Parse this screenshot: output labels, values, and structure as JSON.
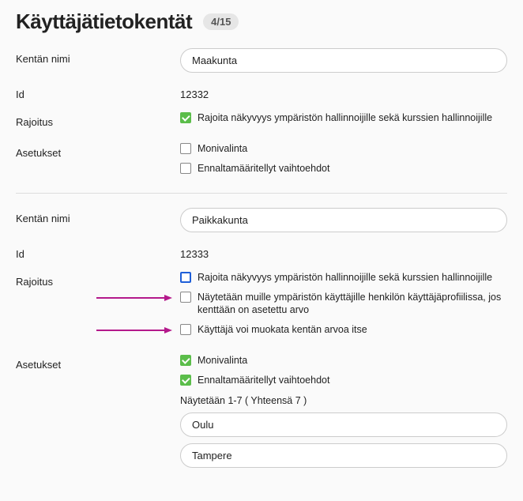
{
  "header": {
    "title": "Käyttäjätietokentät",
    "counter": "4/15"
  },
  "labels": {
    "fieldName": "Kentän nimi",
    "id": "Id",
    "restriction": "Rajoitus",
    "settings": "Asetukset"
  },
  "field1": {
    "name": "Maakunta",
    "id": "12332",
    "restrict": {
      "checked": true,
      "label": "Rajoita näkyvyys ympäristön hallinnoijille sekä kurssien hallinnoijille"
    },
    "settings": {
      "multi": {
        "checked": false,
        "label": "Monivalinta"
      },
      "predef": {
        "checked": false,
        "label": "Ennaltamääritellyt vaihtoehdot"
      }
    }
  },
  "field2": {
    "name": "Paikkakunta",
    "id": "12333",
    "restrictOptions": {
      "restrict": {
        "checked": false,
        "highlight": true,
        "label": "Rajoita näkyvyys ympäristön hallinnoijille sekä kurssien hallinnoijille"
      },
      "showOthers": {
        "checked": false,
        "label": "Näytetään muille ympäristön käyttäjille henkilön käyttäjäprofiilissa, jos kenttään on asetettu arvo"
      },
      "userEdit": {
        "checked": false,
        "label": "Käyttäjä voi muokata kentän arvoa itse"
      }
    },
    "settings": {
      "multi": {
        "checked": true,
        "label": "Monivalinta"
      },
      "predef": {
        "checked": true,
        "label": "Ennaltamääritellyt vaihtoehdot"
      }
    },
    "optionsHeader": "Näytetään 1-7 ( Yhteensä 7 )",
    "options": [
      "Oulu",
      "Tampere"
    ]
  }
}
